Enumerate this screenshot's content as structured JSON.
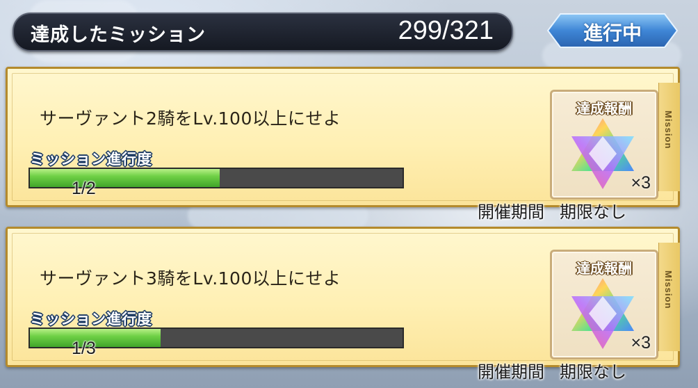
{
  "header": {
    "title": "達成したミッション",
    "count": "299/321",
    "status_label": "進行中"
  },
  "missions": [
    {
      "text": "サーヴァント2騎をLv.100以上にせよ",
      "progress_label": "ミッション進行度",
      "progress_text": "1/2",
      "progress_fraction": 0.5,
      "reward_label": "達成報酬",
      "reward_icon": "rainbow-star-icon",
      "reward_qty": "×3",
      "period_label": "開催期間",
      "period_value": "期限なし",
      "side_tab": "Mission"
    },
    {
      "text": "サーヴァント3騎をLv.100以上にせよ",
      "progress_label": "ミッション進行度",
      "progress_text": "1/3",
      "progress_fraction": 0.3333,
      "reward_label": "達成報酬",
      "reward_icon": "rainbow-star-icon",
      "reward_qty": "×3",
      "period_label": "開催期間",
      "period_value": "期限なし",
      "side_tab": "Mission"
    }
  ],
  "colors": {
    "progress_fill": "#5ec63a",
    "progress_track": "#4a4a4a",
    "card_border": "#b48a2c",
    "status_badge": "#3f86d6"
  }
}
